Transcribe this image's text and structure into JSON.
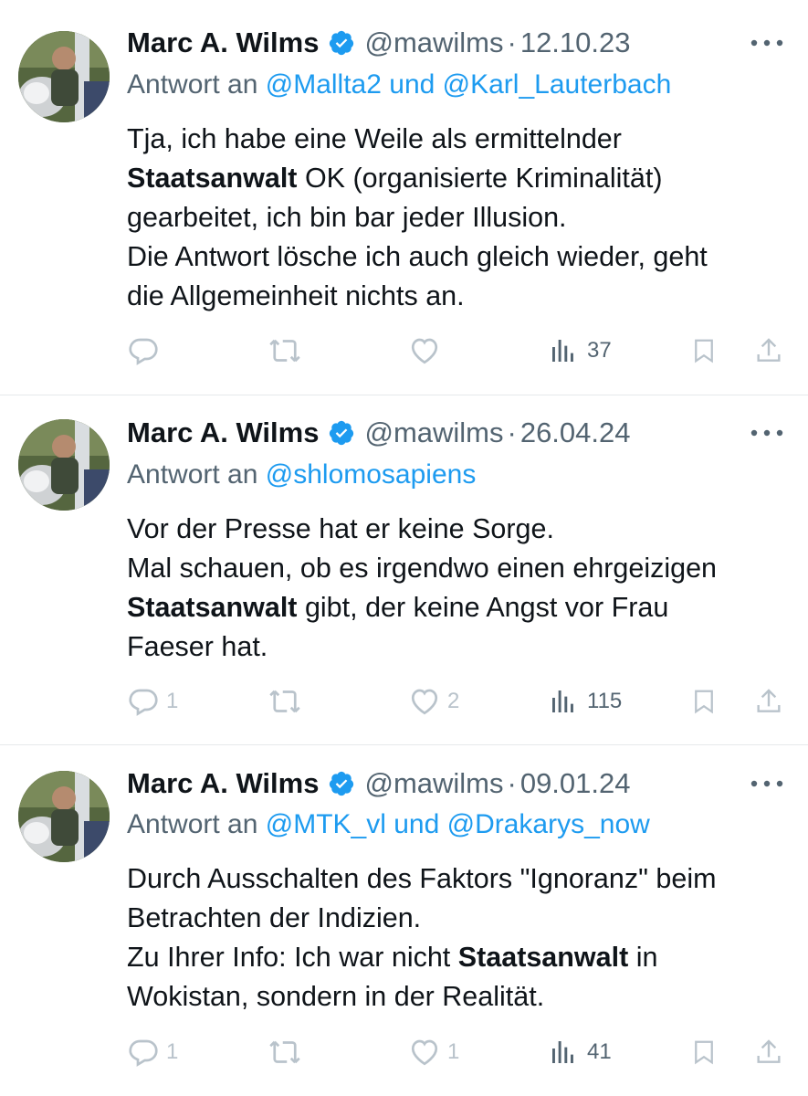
{
  "colors": {
    "text": "#0f1419",
    "secondary": "#536471",
    "link": "#1d9bf0",
    "verified": "#1d9bf0",
    "action_faded": "#b9c3cb",
    "divider": "#e6e9eb"
  },
  "tweets": [
    {
      "author_name": "Marc A. Wilms",
      "handle": "@mawilms",
      "separator": "·",
      "date": "12.10.23",
      "reply_label": "Antwort an",
      "reply_mentions": "@Mallta2 und @Karl_Lauterbach",
      "lines": [
        {
          "pre": "Tja, ich habe eine Weile als ermittelnder",
          "bold": "",
          "post": ""
        },
        {
          "pre": "",
          "bold": "Staatsanwalt",
          "post": " OK (organisierte Kriminalität)"
        },
        {
          "pre": "gearbeitet, ich bin bar jeder Illusion.",
          "bold": "",
          "post": ""
        },
        {
          "pre": "Die Antwort lösche ich auch gleich wieder, geht",
          "bold": "",
          "post": ""
        },
        {
          "pre": "die Allgemeinheit nichts an.",
          "bold": "",
          "post": ""
        }
      ],
      "replies": "",
      "retweets": "",
      "likes": "",
      "views": "37",
      "icons": [
        "reply-icon",
        "retweet-icon",
        "like-icon",
        "views-icon",
        "bookmark-icon",
        "share-icon"
      ]
    },
    {
      "author_name": "Marc A. Wilms",
      "handle": "@mawilms",
      "separator": "·",
      "date": "26.04.24",
      "reply_label": "Antwort an",
      "reply_mentions": "@shlomosapiens",
      "lines": [
        {
          "pre": "Vor der Presse hat er keine Sorge.",
          "bold": "",
          "post": ""
        },
        {
          "pre": "Mal schauen, ob es irgendwo einen ehrgeizigen",
          "bold": "",
          "post": ""
        },
        {
          "pre": "",
          "bold": "Staatsanwalt",
          "post": " gibt, der keine Angst vor Frau"
        },
        {
          "pre": "Faeser hat.",
          "bold": "",
          "post": ""
        }
      ],
      "replies": "1",
      "retweets": "",
      "likes": "2",
      "views": "115",
      "icons": [
        "reply-icon",
        "retweet-icon",
        "like-icon",
        "views-icon",
        "bookmark-icon",
        "share-icon"
      ]
    },
    {
      "author_name": "Marc A. Wilms",
      "handle": "@mawilms",
      "separator": "·",
      "date": "09.01.24",
      "reply_label": "Antwort an",
      "reply_mentions": "@MTK_vl und @Drakarys_now",
      "lines": [
        {
          "pre": "Durch Ausschalten des Faktors \"Ignoranz\" beim",
          "bold": "",
          "post": ""
        },
        {
          "pre": "Betrachten der Indizien.",
          "bold": "",
          "post": ""
        },
        {
          "pre": "Zu Ihrer Info: Ich war nicht ",
          "bold": "Staatsanwalt",
          "post": " in"
        },
        {
          "pre": "Wokistan, sondern in der Realität.",
          "bold": "",
          "post": ""
        }
      ],
      "replies": "1",
      "retweets": "",
      "likes": "1",
      "views": "41",
      "icons": [
        "reply-icon",
        "retweet-icon",
        "like-icon",
        "views-icon",
        "bookmark-icon",
        "share-icon"
      ]
    }
  ]
}
